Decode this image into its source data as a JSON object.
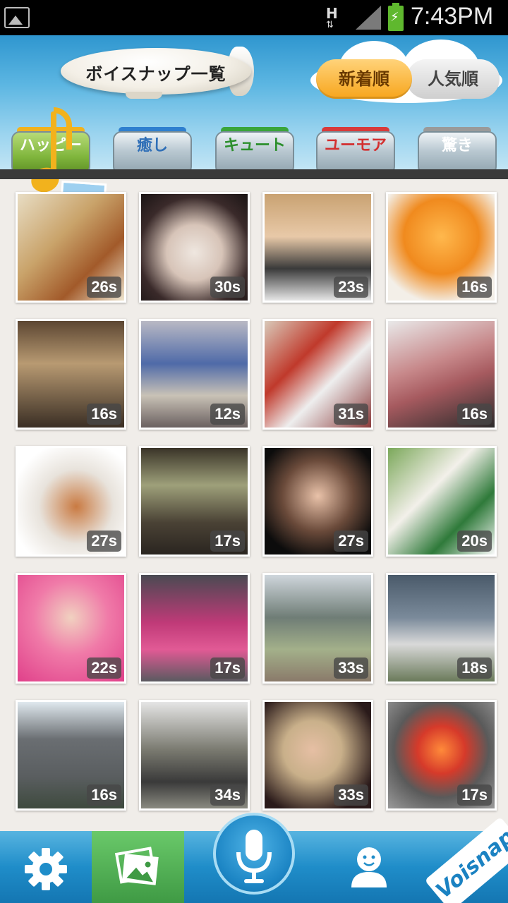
{
  "status_bar": {
    "network": "H",
    "time": "7:43PM"
  },
  "header": {
    "title": "ボイスナップ一覧",
    "sort_new": "新着順",
    "sort_popular": "人気順"
  },
  "categories": [
    {
      "label": "ハッピー",
      "lid": "#f2b21d",
      "color": "#ffffff"
    },
    {
      "label": "癒し",
      "lid": "#2f7fcf",
      "color": "#2f6fb7"
    },
    {
      "label": "キュート",
      "lid": "#3aa53a",
      "color": "#2c8f2c"
    },
    {
      "label": "ユーモア",
      "lid": "#d83a3a",
      "color": "#d32f2f"
    },
    {
      "label": "驚き",
      "lid": "#9a9a9a",
      "color": "#ffffff"
    }
  ],
  "tiles": [
    {
      "duration": "26s",
      "bg": "linear-gradient(135deg,#e8ddc4 0%,#c9a36a 40%,#a25a2a 70%,#efe6d0 100%)"
    },
    {
      "duration": "30s",
      "bg": "radial-gradient(circle at 50% 55%,#efe7e0 0%,#d7c4b8 35%,#3a2a2a 70%,#1a1414 100%)"
    },
    {
      "duration": "23s",
      "bg": "linear-gradient(180deg,#c9a272 0%,#e8c9a8 40%,#3a3a3a 70%,#e6e6e6 100%)"
    },
    {
      "duration": "16s",
      "bg": "radial-gradient(circle at 50% 40%,#ffb84d 0%,#f08a1e 45%,#f3efe8 80%)"
    },
    {
      "duration": "16s",
      "bg": "linear-gradient(180deg,#5c4632 0%,#b89a72 40%,#3a2e24 100%)"
    },
    {
      "duration": "12s",
      "bg": "linear-gradient(180deg,#b9b9c4 0%,#4f6aa8 40%,#c9c2b6 70%,#6a6060 100%)"
    },
    {
      "duration": "31s",
      "bg": "linear-gradient(135deg,#d9c9b9 0%,#c0392b 35%,#eee 60%,#8a3a3a 100%)"
    },
    {
      "duration": "16s",
      "bg": "linear-gradient(160deg,#e9e9e9 0%,#c7888a 40%,#a65a5f 60%,#2b2b2b 100%)"
    },
    {
      "duration": "27s",
      "bg": "radial-gradient(circle at 55% 55%,#c97a42 0%,#e8e3dc 45%,#ffffff 80%)"
    },
    {
      "duration": "17s",
      "bg": "linear-gradient(180deg,#3a3428 0%,#9ea07a 35%,#4a4235 70%,#2a2520 100%)"
    },
    {
      "duration": "27s",
      "bg": "radial-gradient(circle at 50% 45%,#e9c2a9 0%,#6a4a3a 45%,#0c0c0c 80%)"
    },
    {
      "duration": "20s",
      "bg": "linear-gradient(135deg,#7ba85a 0%,#f3f0ea 40%,#2f7a3a 70%,#fafafa 100%)"
    },
    {
      "duration": "22s",
      "bg": "radial-gradient(circle at 50% 40%,#f1d1c0 0%,#f07aa8 45%,#e0408a 100%)"
    },
    {
      "duration": "17s",
      "bg": "linear-gradient(180deg,#4a4a52 0%,#c03a78 45%,#e15a95 70%,#5a5a60 100%)"
    },
    {
      "duration": "33s",
      "bg": "linear-gradient(180deg,#cfd6dc 0%,#6f7d76 40%,#a3b08a 70%,#8a7a6a 100%)"
    },
    {
      "duration": "18s",
      "bg": "linear-gradient(180deg,#4a5a6a 0%,#7a8a9a 40%,#d9d9d9 65%,#6a7a5a 100%)"
    },
    {
      "duration": "16s",
      "bg": "linear-gradient(180deg,#dfe8ee 0%,#6a6e72 35%,#5a5e60 70%,#3e4a3e 100%)"
    },
    {
      "duration": "34s",
      "bg": "linear-gradient(180deg,#e5e5e5 0%,#7a7a70 45%,#3a3a3a 75%,#8a8a80 100%)"
    },
    {
      "duration": "33s",
      "bg": "radial-gradient(circle at 45% 45%,#e6bfa4 0%,#c9b08a 35%,#2a1a1a 80%)"
    },
    {
      "duration": "17s",
      "bg": "radial-gradient(circle at 50% 45%,#ff8a3a 0%,#d63a2a 30%,#5a5a5a 60%,#9a9a9a 100%)"
    }
  ],
  "bottom_nav": {
    "brand": "Voisnap"
  }
}
